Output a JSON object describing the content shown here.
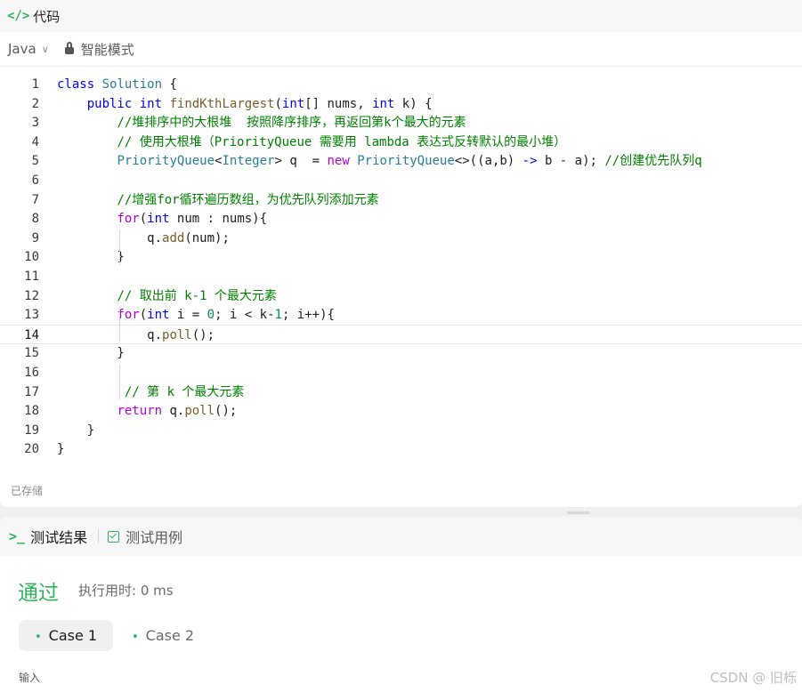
{
  "code_panel": {
    "title": "代码",
    "language": "Java",
    "mode": "智能模式",
    "saved_status": "已存储"
  },
  "code_lines": [
    {
      "n": "1",
      "t": [
        [
          "kw",
          "class"
        ],
        [
          "p",
          " "
        ],
        [
          "ty",
          "Solution"
        ],
        [
          "p",
          " {"
        ]
      ]
    },
    {
      "n": "2",
      "t": [
        [
          "p",
          "    "
        ],
        [
          "kw",
          "public"
        ],
        [
          "p",
          " "
        ],
        [
          "kw",
          "int"
        ],
        [
          "p",
          " "
        ],
        [
          "fn",
          "findKthLargest"
        ],
        [
          "p",
          "("
        ],
        [
          "kw",
          "int"
        ],
        [
          "p",
          "[] nums, "
        ],
        [
          "kw",
          "int"
        ],
        [
          "p",
          " k) {"
        ]
      ]
    },
    {
      "n": "3",
      "t": [
        [
          "p",
          "        "
        ],
        [
          "cm",
          "//堆排序中的大根堆  按照降序排序，再返回第k个最大的元素"
        ]
      ]
    },
    {
      "n": "4",
      "t": [
        [
          "p",
          "        "
        ],
        [
          "cm",
          "// 使用大根堆（PriorityQueue 需要用 lambda 表达式反转默认的最小堆）"
        ]
      ]
    },
    {
      "n": "5",
      "t": [
        [
          "p",
          "        "
        ],
        [
          "ty",
          "PriorityQueue"
        ],
        [
          "p",
          "<"
        ],
        [
          "ty",
          "Integer"
        ],
        [
          "p",
          "> q  = "
        ],
        [
          "kw2",
          "new"
        ],
        [
          "p",
          " "
        ],
        [
          "ty",
          "PriorityQueue"
        ],
        [
          "p",
          "<>((a,b) "
        ],
        [
          "kw",
          "->"
        ],
        [
          "p",
          " b - a); "
        ],
        [
          "cm",
          "//创建优先队列q"
        ]
      ]
    },
    {
      "n": "6",
      "t": []
    },
    {
      "n": "7",
      "t": [
        [
          "p",
          "        "
        ],
        [
          "cm",
          "//增强for循环遍历数组，为优先队列添加元素"
        ]
      ]
    },
    {
      "n": "8",
      "t": [
        [
          "p",
          "        "
        ],
        [
          "kw2",
          "for"
        ],
        [
          "p",
          "("
        ],
        [
          "kw",
          "int"
        ],
        [
          "p",
          " num : nums){"
        ]
      ]
    },
    {
      "n": "9",
      "t": [
        [
          "p",
          "            q."
        ],
        [
          "fn",
          "add"
        ],
        [
          "p",
          "(num);"
        ]
      ]
    },
    {
      "n": "10",
      "t": [
        [
          "p",
          "        }"
        ]
      ]
    },
    {
      "n": "11",
      "t": []
    },
    {
      "n": "12",
      "t": [
        [
          "p",
          "        "
        ],
        [
          "cm",
          "// 取出前 k-1 个最大元素"
        ]
      ]
    },
    {
      "n": "13",
      "t": [
        [
          "p",
          "        "
        ],
        [
          "kw2",
          "for"
        ],
        [
          "p",
          "("
        ],
        [
          "kw",
          "int"
        ],
        [
          "p",
          " i = "
        ],
        [
          "nm",
          "0"
        ],
        [
          "p",
          "; i < k-"
        ],
        [
          "nm",
          "1"
        ],
        [
          "p",
          "; i++){"
        ]
      ]
    },
    {
      "n": "14",
      "t": [
        [
          "p",
          "            q."
        ],
        [
          "fn",
          "poll"
        ],
        [
          "p",
          "();"
        ]
      ]
    },
    {
      "n": "15",
      "t": [
        [
          "p",
          "        }"
        ]
      ]
    },
    {
      "n": "16",
      "t": []
    },
    {
      "n": "17",
      "t": [
        [
          "p",
          "         "
        ],
        [
          "cm",
          "// 第 k 个最大元素"
        ]
      ]
    },
    {
      "n": "18",
      "t": [
        [
          "p",
          "        "
        ],
        [
          "kw2",
          "return"
        ],
        [
          "p",
          " q."
        ],
        [
          "fn",
          "poll"
        ],
        [
          "p",
          "();"
        ]
      ]
    },
    {
      "n": "19",
      "t": [
        [
          "p",
          "    }"
        ]
      ]
    },
    {
      "n": "20",
      "t": [
        [
          "p",
          "}"
        ]
      ]
    }
  ],
  "active_line": "14",
  "result_panel": {
    "tab_results": "测试结果",
    "tab_cases": "测试用例",
    "status": "通过",
    "runtime": "执行用时: 0 ms",
    "cases": [
      "Case 1",
      "Case 2"
    ],
    "input_label": "输入"
  },
  "watermark": "CSDN @ 旧栎",
  "colors": {
    "accent_green": "#2db55d",
    "keyword_blue": "#0000ff",
    "keyword_purple": "#af00db",
    "type_teal": "#267f99",
    "function_brown": "#795e26",
    "comment_green": "#008000"
  }
}
